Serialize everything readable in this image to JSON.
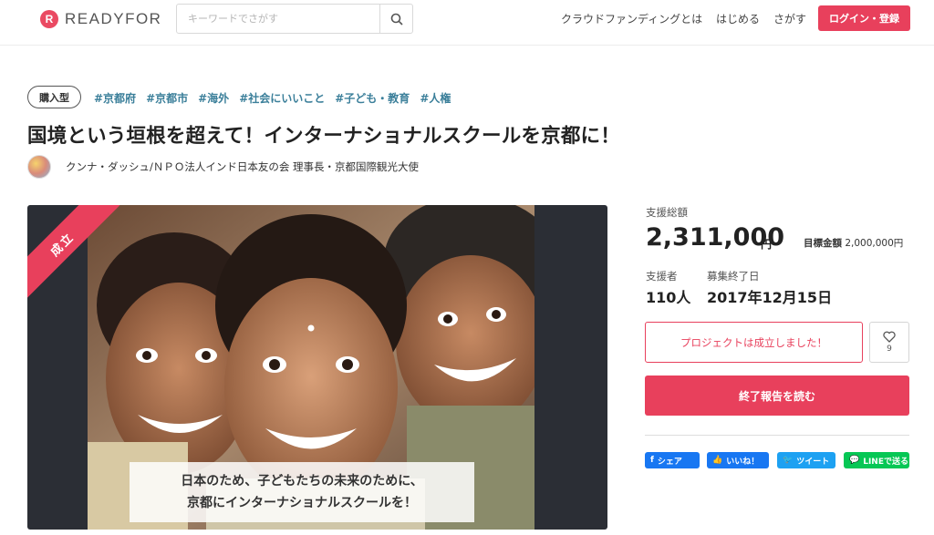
{
  "header": {
    "logo_mark": "R",
    "logo_text": "READYFOR",
    "search_placeholder": "キーワードでさがす",
    "nav": [
      "クラウドファンディングとは",
      "はじめる",
      "さがす"
    ],
    "login_label": "ログイン・登録"
  },
  "project": {
    "type_badge": "購入型",
    "tags": [
      "#京都府",
      "#京都市",
      "#海外",
      "#社会にいいこと",
      "#子ども・教育",
      "#人権"
    ],
    "title": "国境という垣根を超えて！インターナショナルスクールを京都に！",
    "owner": "クンナ・ダッシュ/ＮＰＯ法人インド日本友の会 理事長・京都国際観光大使"
  },
  "media": {
    "ribbon": "成立",
    "caption_lines": [
      "日本のため、子どもたちの未来のために、",
      "京都にインターナショナルスクールを！"
    ]
  },
  "stats": {
    "total_label": "支援総額",
    "total_value": "2,311,000",
    "total_unit": "円",
    "goal_label": "目標金額",
    "goal_value": "2,000,000円",
    "supporters_label": "支援者",
    "supporters_value": "110人",
    "end_label": "募集終了日",
    "end_value": "2017年12月15日"
  },
  "actions": {
    "success_text": "プロジェクトは成立しました！",
    "favorite_count": "9",
    "report_label": "終了報告を読む"
  },
  "share": {
    "facebook": "シェア",
    "like": "いいね！",
    "twitter": "ツイート",
    "line": "LINEで送る"
  },
  "colors": {
    "accent": "#e8405c",
    "tag": "#3b7f9a",
    "facebook": "#1877f2",
    "twitter": "#1da1f2",
    "line": "#06c755"
  }
}
